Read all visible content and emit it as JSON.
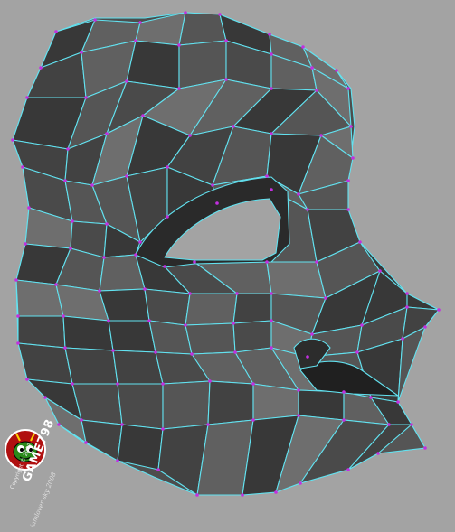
{
  "colors": {
    "background": "#a3a3a3",
    "wireframe": "#62e2f0",
    "vertex": "#c22fe0",
    "face_light": "#6e6e6e",
    "face_mid": "#555555",
    "face_dark": "#383838"
  },
  "watermark": {
    "title": "GAME798",
    "copyright": "Copyright © 2007",
    "subtitle": "iamlover sky 2008",
    "icon": "bug-mascot-icon"
  }
}
